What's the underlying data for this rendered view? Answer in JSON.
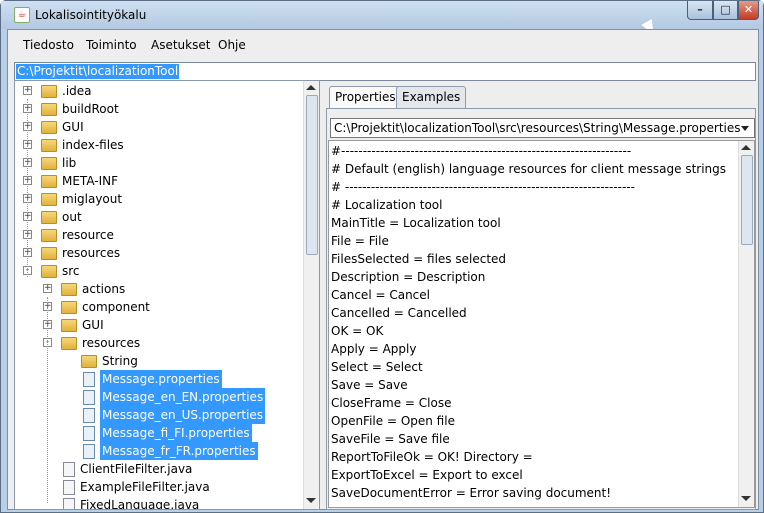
{
  "window": {
    "title": "Lokalisointityökalu",
    "app_icon": "java-cup-icon"
  },
  "menu": [
    {
      "label": "Tiedosto"
    },
    {
      "label": "Toiminto"
    },
    {
      "label": "Asetukset"
    },
    {
      "label": "Ohje"
    }
  ],
  "path": {
    "value": "C:\\Projektit\\localizationTool"
  },
  "tree": [
    {
      "label": ".idea",
      "type": "folder",
      "exp": "+"
    },
    {
      "label": "buildRoot",
      "type": "folder",
      "exp": "+"
    },
    {
      "label": "GUI",
      "type": "folder",
      "exp": "+"
    },
    {
      "label": "index-files",
      "type": "folder",
      "exp": "+"
    },
    {
      "label": "lib",
      "type": "folder",
      "exp": "+"
    },
    {
      "label": "META-INF",
      "type": "folder",
      "exp": "+"
    },
    {
      "label": "miglayout",
      "type": "folder",
      "exp": "+"
    },
    {
      "label": "out",
      "type": "folder",
      "exp": "+"
    },
    {
      "label": "resource",
      "type": "folder",
      "exp": "+"
    },
    {
      "label": "resources",
      "type": "folder",
      "exp": "+"
    },
    {
      "label": "src",
      "type": "folder",
      "exp": "-"
    },
    {
      "label": "actions",
      "type": "folder",
      "exp": "+"
    },
    {
      "label": "component",
      "type": "folder",
      "exp": "+"
    },
    {
      "label": "GUI",
      "type": "folder",
      "exp": "+"
    },
    {
      "label": "resources",
      "type": "folder",
      "exp": "-"
    },
    {
      "label": "String",
      "type": "folder",
      "exp": ""
    },
    {
      "label": "Message.properties",
      "type": "prop",
      "sel": true
    },
    {
      "label": "Message_en_EN.properties",
      "type": "prop",
      "sel": true
    },
    {
      "label": "Message_en_US.properties",
      "type": "prop",
      "sel": true
    },
    {
      "label": "Message_fi_FI.properties",
      "type": "prop",
      "sel": true
    },
    {
      "label": "Message_fr_FR.properties",
      "type": "prop",
      "sel": true
    },
    {
      "label": "ClientFileFilter.java",
      "type": "file"
    },
    {
      "label": "ExampleFileFilter.java",
      "type": "file"
    },
    {
      "label": "FixedLanguage.java",
      "type": "file"
    }
  ],
  "tabs": [
    {
      "label": "Properties"
    },
    {
      "label": "Examples"
    }
  ],
  "file_combo": {
    "value": "C:\\Projektit\\localizationTool\\src\\resources\\String\\Message.properties"
  },
  "editor_lines": [
    "#-------------------------------------------------------------------",
    "# Default (english) language resources for client message strings",
    "# -------------------------------------------------------------------",
    "# Localization tool",
    "MainTitle = Localization tool",
    "File = File",
    "FilesSelected = files selected",
    "Description = Description",
    "Cancel = Cancel",
    "Cancelled = Cancelled",
    "OK = OK",
    "Apply = Apply",
    "Select = Select",
    "Save = Save",
    "CloseFrame = Close",
    "OpenFile = Open file",
    "SaveFile = Save file",
    "ReportToFileOk = OK! Directory =",
    "ExportToExcel = Export to excel",
    "SaveDocumentError = Error saving document!"
  ]
}
